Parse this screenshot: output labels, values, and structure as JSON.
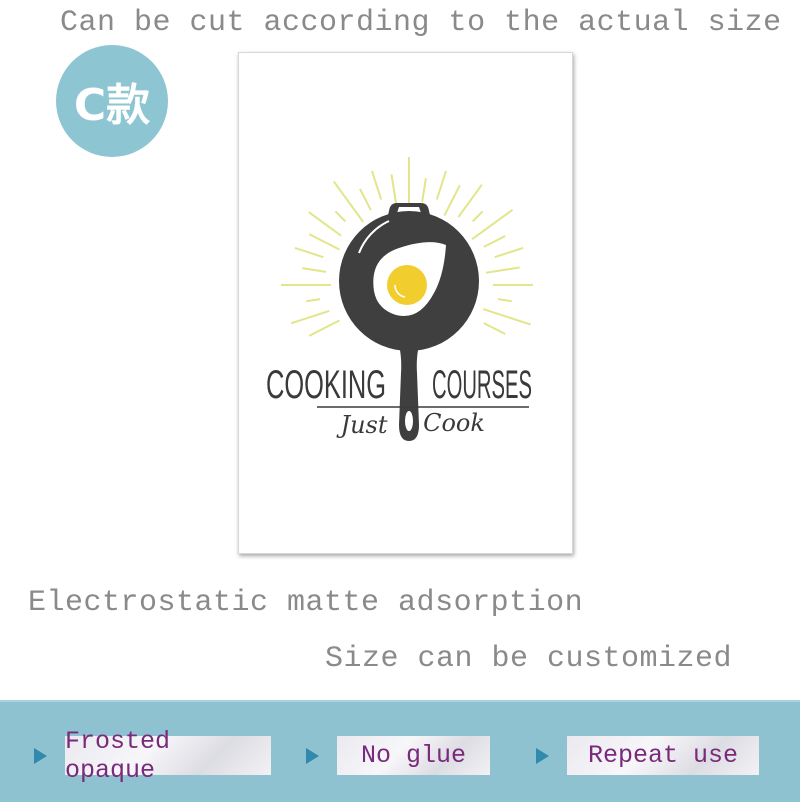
{
  "top_caption": "Can be cut according to the actual size",
  "badge": {
    "label": "C款",
    "color": "#8ec5d3"
  },
  "poster": {
    "title_left": "COOKING",
    "title_right": "COURSES",
    "tagline_left": "Just",
    "tagline_right": "Cook",
    "colors": {
      "pan": "#3f3f3f",
      "yolk": "#f2cd2e",
      "rays": "#e2e58a"
    }
  },
  "caption_2": "Electrostatic matte adsorption",
  "caption_3": "Size can be customized",
  "features": [
    {
      "label": "Frosted opaque",
      "icon": "triangle-right-icon"
    },
    {
      "label": "No glue",
      "icon": "triangle-right-icon"
    },
    {
      "label": "Repeat use",
      "icon": "triangle-right-icon"
    }
  ],
  "band_color": "#8ec2d1"
}
